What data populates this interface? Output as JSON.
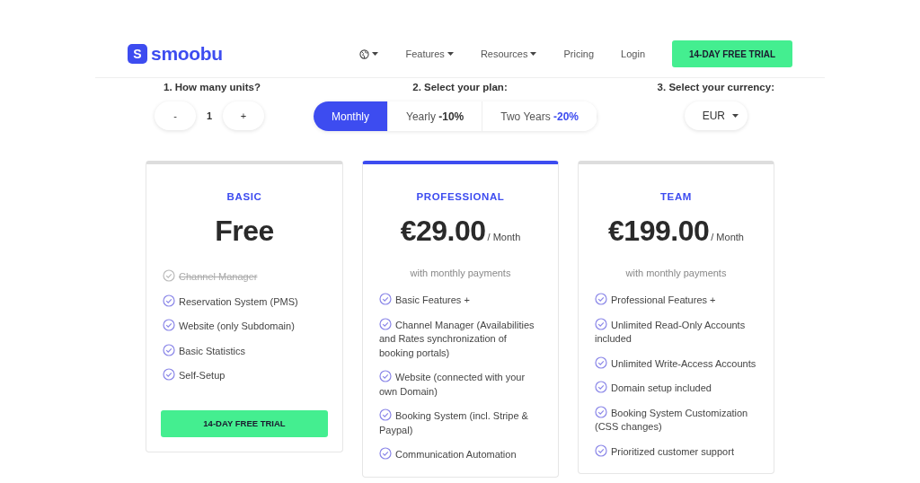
{
  "header": {
    "logo_mark": "S",
    "logo_text": "smoobu",
    "nav": [
      {
        "kind": "language"
      },
      {
        "kind": "menu",
        "label": "Features"
      },
      {
        "kind": "menu",
        "label": "Resources"
      },
      {
        "kind": "link",
        "label": "Pricing"
      },
      {
        "kind": "link",
        "label": "Login"
      }
    ],
    "cta": "14-DAY FREE TRIAL"
  },
  "units": {
    "label": "1. How many units?",
    "decrement": "-",
    "value": "1",
    "increment": "+"
  },
  "plan": {
    "label": "2. Select your plan:",
    "options": [
      {
        "label": "Monthly",
        "selected": true
      },
      {
        "label": "Yearly",
        "discount": "-10%",
        "color": "#333333",
        "selected": false
      },
      {
        "label": "Two Years",
        "discount": "-20%",
        "color": "#3d4cf0",
        "selected": false
      }
    ]
  },
  "currency": {
    "label": "3. Select your currency:",
    "value": "EUR"
  },
  "cards": [
    {
      "name": "BASIC",
      "price": "Free",
      "selected": false,
      "features": [
        {
          "text": "Channel Manager",
          "included": false
        },
        {
          "text": "Reservation System (PMS)",
          "included": true
        },
        {
          "text": "Website (only Subdomain)",
          "included": true
        },
        {
          "text": "Basic Statistics",
          "included": true
        },
        {
          "text": "Self-Setup",
          "included": true
        }
      ],
      "button": "14-DAY FREE TRIAL"
    },
    {
      "name": "PROFESSIONAL",
      "price": "€29.00",
      "period": "/ Month",
      "note": "with monthly payments",
      "selected": true,
      "features": [
        {
          "text": "Basic Features +",
          "included": true
        },
        {
          "text": "Channel Manager (Availabilities and Rates synchronization of booking portals)",
          "included": true
        },
        {
          "text": "Website (connected with your own Domain)",
          "included": true
        },
        {
          "text": "Booking System (incl. Stripe & Paypal)",
          "included": true
        },
        {
          "text": "Communication Automation",
          "included": true
        }
      ]
    },
    {
      "name": "TEAM",
      "price": "€199.00",
      "period": "/ Month",
      "note": "with monthly payments",
      "selected": false,
      "features": [
        {
          "text": "Professional Features +",
          "included": true
        },
        {
          "text": "Unlimited Read-Only Accounts included",
          "included": true
        },
        {
          "text": "Unlimited Write-Access Accounts",
          "included": true
        },
        {
          "text": "Domain setup included",
          "included": true
        },
        {
          "text": "Booking System Customization (CSS changes)",
          "included": true
        },
        {
          "text": "Prioritized customer support",
          "included": true
        }
      ]
    }
  ]
}
